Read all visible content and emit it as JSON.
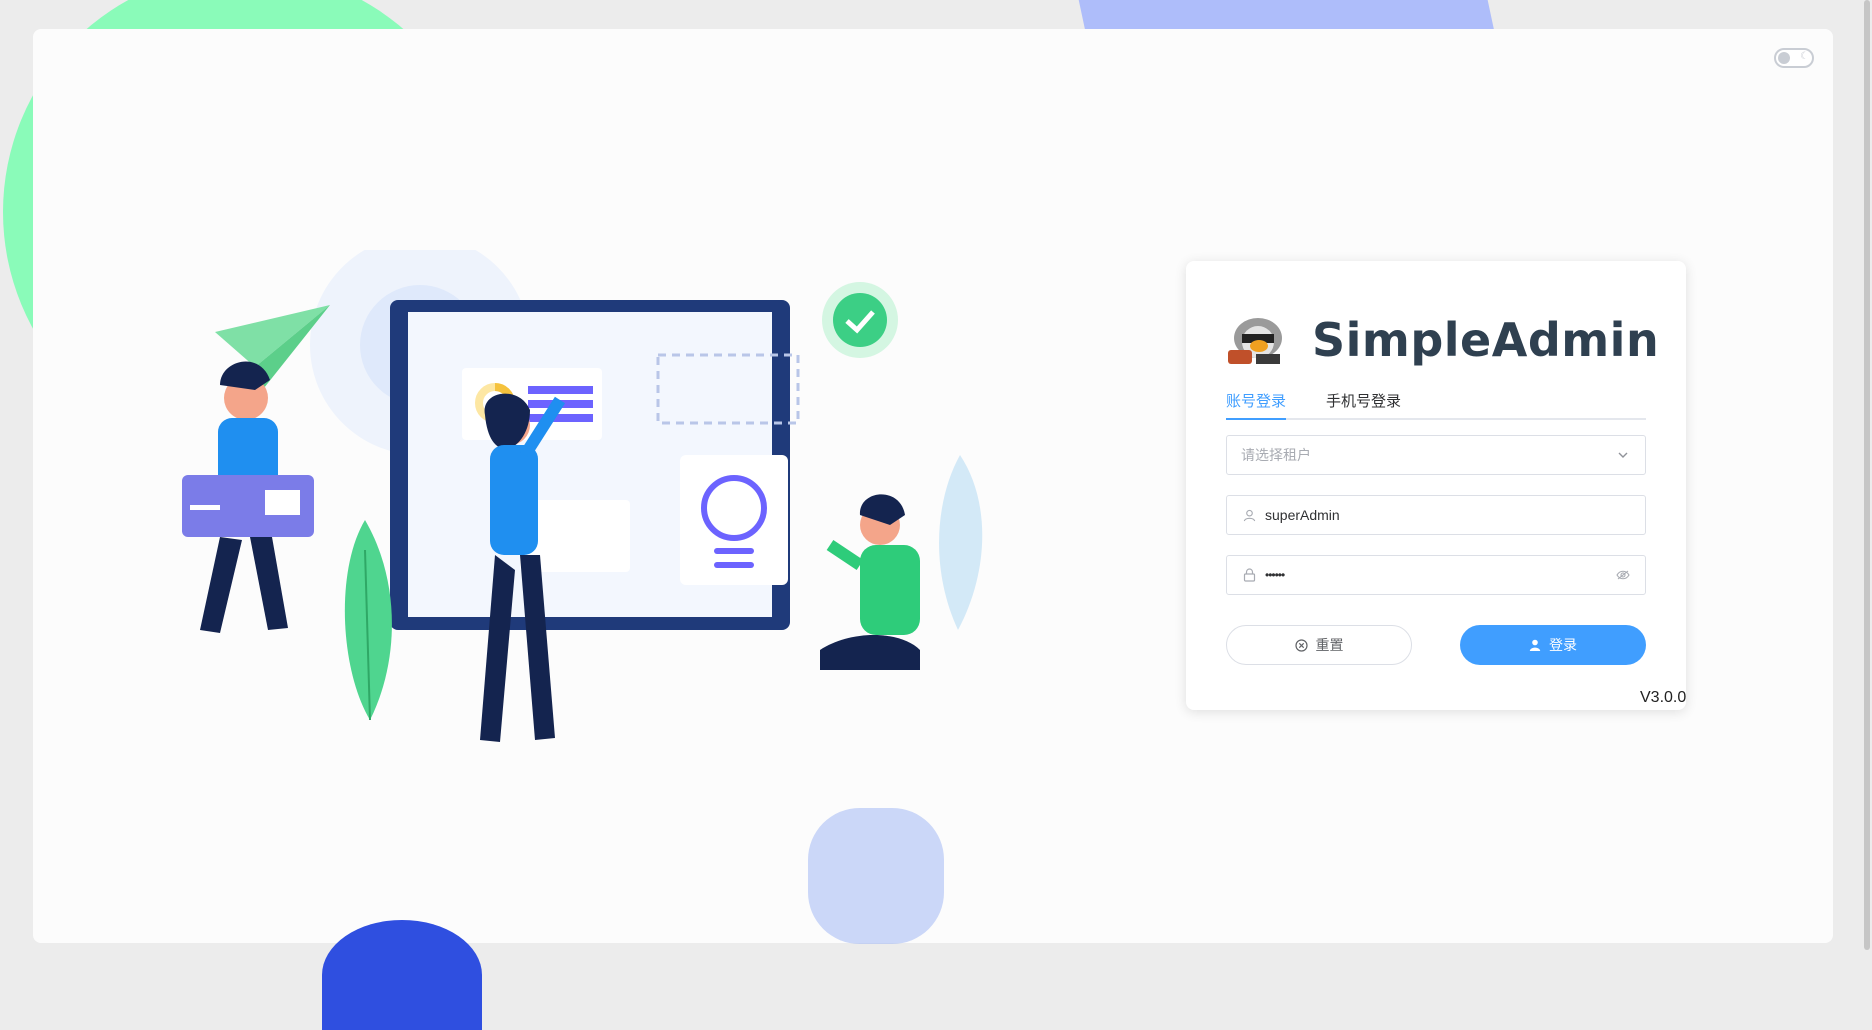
{
  "app": {
    "title": "SimpleAdmin",
    "version": "V3.0.0"
  },
  "tabs": [
    {
      "label": "账号登录",
      "active": true
    },
    {
      "label": "手机号登录",
      "active": false
    }
  ],
  "form": {
    "tenant": {
      "placeholder": "请选择租户",
      "value": ""
    },
    "username": {
      "value": "superAdmin"
    },
    "password": {
      "value": "••••••"
    }
  },
  "buttons": {
    "reset": "重置",
    "login": "登录"
  },
  "colors": {
    "primary": "#409eff",
    "title": "#2f4050"
  },
  "icons": [
    "theme-toggle-icon",
    "chevron-down-icon",
    "user-icon",
    "lock-icon",
    "eye-icon",
    "close-circle-icon"
  ]
}
